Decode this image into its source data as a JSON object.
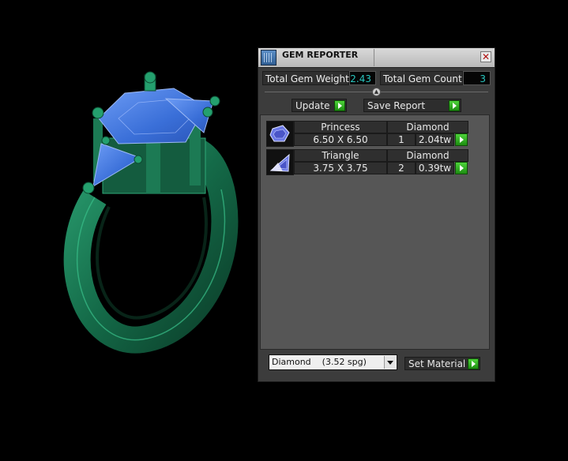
{
  "window": {
    "title": "GEM REPORTER",
    "close_glyph": "✕"
  },
  "summary": {
    "total_weight_label": "Total Gem Weight",
    "total_weight_value": "2.43",
    "total_count_label": "Total Gem Count",
    "total_count_value": "3"
  },
  "toolbar": {
    "update_label": "Update",
    "save_report_label": "Save Report"
  },
  "gems": [
    {
      "shape": "Princess",
      "material": "Diamond",
      "size": "6.50 X 6.50",
      "count": "1",
      "weight": "2.04tw",
      "icon": "princess-gem-icon"
    },
    {
      "shape": "Triangle",
      "material": "Diamond",
      "size": "3.75 X 3.75",
      "count": "2",
      "weight": "0.39tw",
      "icon": "triangle-gem-icon"
    }
  ],
  "footer": {
    "material_select_value": "Diamond    (3.52 spg)",
    "set_material_label": "Set Material"
  },
  "colors": {
    "ring_metal": "#1a6e4c",
    "gem_blue": "#3f78e0",
    "panel_bg": "#3c3c3c",
    "value_text": "#29c7c0",
    "go_button": "#2fb51d"
  }
}
